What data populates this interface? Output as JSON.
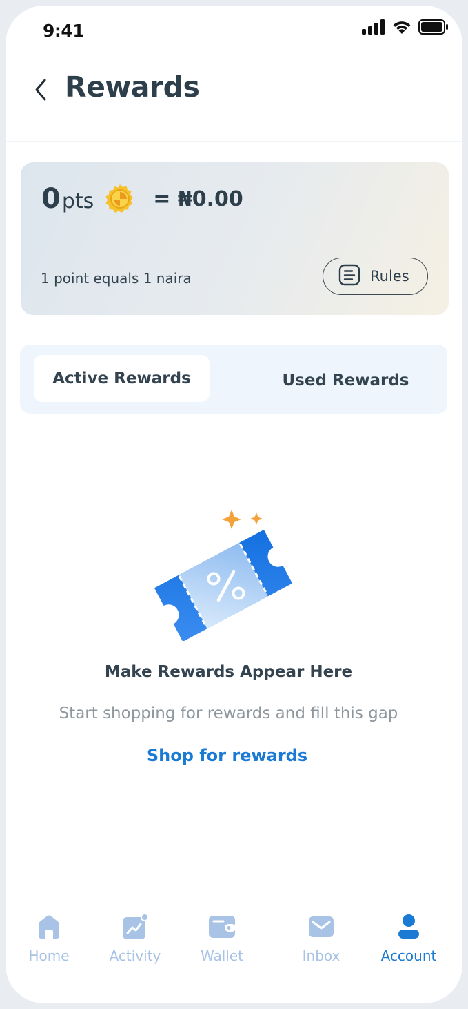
{
  "status_bar": {
    "time": "9:41",
    "icons": [
      "cellular-signal-icon",
      "wifi-icon",
      "battery-icon"
    ]
  },
  "header": {
    "title": "Rewards",
    "back_icon": "chevron-left-icon"
  },
  "points_card": {
    "points_value": "0",
    "points_unit": "pts",
    "coin_icon": "coin-icon",
    "naira_value": "= ₦0.00",
    "note": "1 point equals 1 naira",
    "rules_label": "Rules",
    "rules_icon": "document-icon"
  },
  "tabs": [
    {
      "label": "Active Rewards",
      "active": true
    },
    {
      "label": "Used Rewards",
      "active": false
    }
  ],
  "empty_state": {
    "illustration": "coupon-ticket-icon",
    "title": "Make Rewards Appear Here",
    "subtitle": "Start shopping for rewards and fill this gap",
    "link": "Shop for rewards"
  },
  "bottom_nav": [
    {
      "label": "Home",
      "icon": "home-icon",
      "active": false
    },
    {
      "label": "Activity",
      "icon": "activity-icon",
      "active": false
    },
    {
      "label": "Wallet",
      "icon": "wallet-icon",
      "active": false
    },
    {
      "label": "Inbox",
      "icon": "inbox-icon",
      "active": false
    },
    {
      "label": "Account",
      "icon": "account-icon",
      "active": true
    }
  ],
  "colors": {
    "accent": "#1b7bd4",
    "inactive_nav": "#a8c3e6",
    "text_dark": "#2e3f4c",
    "tab_bg": "#eef5fd"
  }
}
